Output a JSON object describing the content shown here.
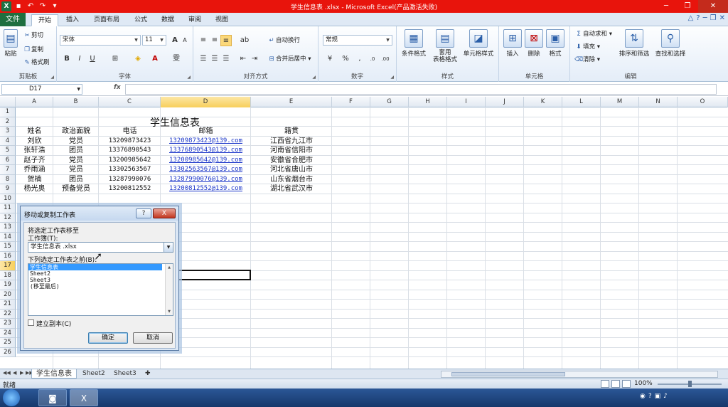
{
  "window": {
    "title": "学生信息表 .xlsx - Microsoft Excel(产品激活失败)",
    "badge": "52"
  },
  "ribbon_tabs": [
    "开始",
    "插入",
    "页面布局",
    "公式",
    "数据",
    "审阅",
    "视图"
  ],
  "file_tab": "文件",
  "ribbon": {
    "clipboard": {
      "paste": "粘贴",
      "cut": "剪切",
      "copy": "复制",
      "format_painter": "格式刷",
      "label": "剪贴板"
    },
    "font": {
      "name": "宋体",
      "size": "11",
      "label": "字体",
      "grow": "A",
      "shrink": "A"
    },
    "alignment": {
      "wrap_text": "自动换行",
      "merge_center": "合并后居中",
      "label": "对齐方式"
    },
    "number": {
      "format": "常规",
      "label": "数字"
    },
    "styles": {
      "conditional": "条件格式",
      "table_format": "套用\n表格格式",
      "cell_styles": "单元格样式",
      "label": "样式"
    },
    "cells": {
      "insert": "插入",
      "delete": "删除",
      "format": "格式",
      "label": "单元格"
    },
    "editing": {
      "autosum": "自动求和",
      "fill": "填充",
      "clear": "清除",
      "sort_filter": "排序和筛选",
      "find_select": "查找和选择",
      "label": "编辑"
    }
  },
  "formula_bar": {
    "name_box": "D17",
    "fx": "fx",
    "value": ""
  },
  "columns": [
    "A",
    "B",
    "C",
    "D",
    "E",
    "F",
    "G",
    "H",
    "I",
    "J",
    "K",
    "L",
    "M",
    "N",
    "O"
  ],
  "rows": [
    "1",
    "2",
    "3",
    "4",
    "5",
    "6",
    "7",
    "8",
    "9",
    "10",
    "11",
    "12",
    "13",
    "14",
    "15",
    "16",
    "17",
    "18",
    "19",
    "20",
    "21",
    "22",
    "23",
    "24",
    "25",
    "26"
  ],
  "selected_row": "17",
  "selected_col": "D",
  "sheet": {
    "title": "学生信息表",
    "headers": [
      "姓名",
      "政治面貌",
      "电话",
      "邮箱",
      "籍贯"
    ],
    "records": [
      [
        "刘欣",
        "党员",
        "13209873423",
        "13209873423@139.com",
        "江西省九江市"
      ],
      [
        "张轩浩",
        "团员",
        "13376890543",
        "13376890543@139.com",
        "河南省信阳市"
      ],
      [
        "赵子齐",
        "党员",
        "13200985642",
        "13200985642@139.com",
        "安徽省合肥市"
      ],
      [
        "乔雨涵",
        "党员",
        "13302563567",
        "13302563567@139.com",
        "河北省唐山市"
      ],
      [
        "贺楠",
        "团员",
        "13287990076",
        "13287990076@139.com",
        "山东省烟台市"
      ],
      [
        "杨光奥",
        "预备党员",
        "13200812552",
        "13200812552@139.com",
        "湖北省武汉市"
      ]
    ]
  },
  "sheet_tabs": [
    "学生信息表",
    "Sheet2",
    "Sheet3"
  ],
  "status": {
    "text": "就绪",
    "zoom": "100%"
  },
  "dialog": {
    "title": "移动或复制工作表",
    "help": "?",
    "close": "X",
    "move_to_label": "将选定工作表移至",
    "workbook_label": "工作簿(T):",
    "workbook_value": "学生信息表 .xlsx",
    "before_label": "下列选定工作表之前(B):",
    "list_items": [
      "学生信息表",
      "Sheet2",
      "Sheet3",
      "(移至最后)"
    ],
    "copy_label": "建立副本(C)",
    "ok": "确定",
    "cancel": "取消"
  }
}
